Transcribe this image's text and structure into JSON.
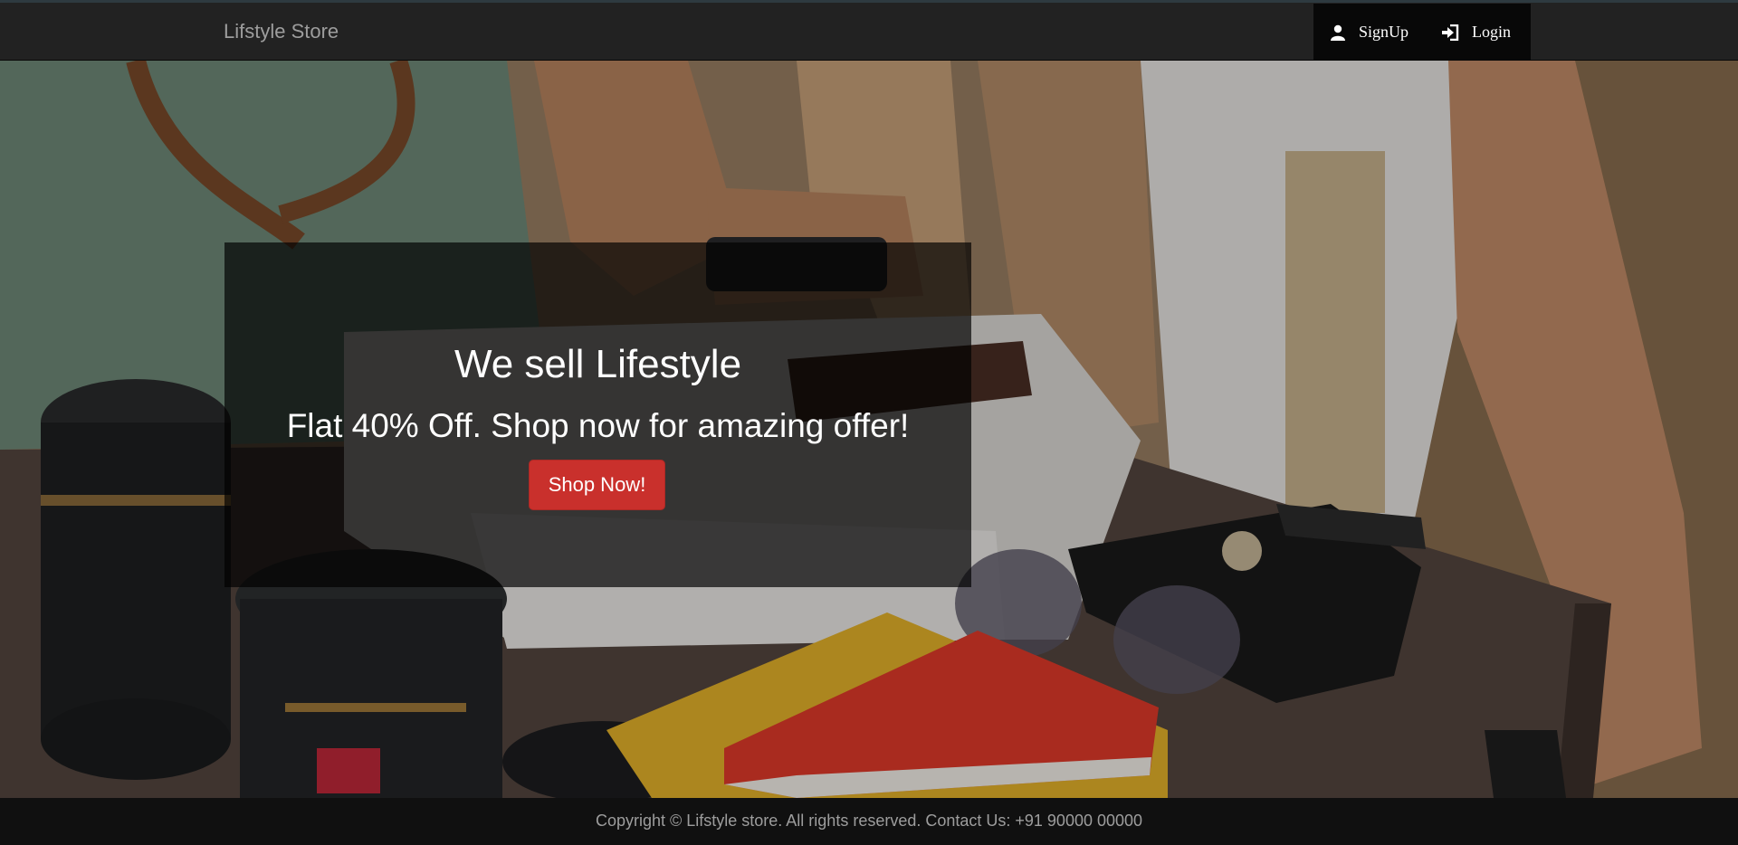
{
  "navbar": {
    "brand": "Lifstyle Store",
    "links": [
      {
        "label": "SignUp",
        "icon": "user-icon"
      },
      {
        "label": "Login",
        "icon": "login-icon"
      }
    ]
  },
  "hero": {
    "heading": "We sell Lifestyle",
    "subheading": "Flat 40% Off. Shop now for amazing offer!",
    "cta_label": "Shop Now!",
    "cta_color": "#c9302c"
  },
  "footer": {
    "text": "Copyright © Lifstyle store. All rights reserved. Contact Us: +91 90000 00000"
  }
}
